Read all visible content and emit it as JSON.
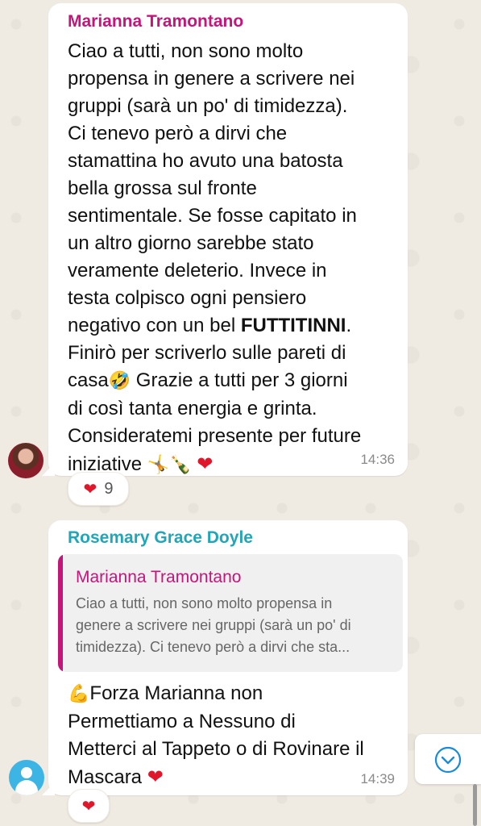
{
  "message1": {
    "sender": "Marianna Tramontano",
    "lines": [
      "Ciao a tutti, non sono molto",
      "propensa in genere a scrivere nei",
      "gruppi (sarà un po' di timidezza).",
      "Ci tenevo però a dirvi che",
      "stamattina ho avuto una batosta",
      "bella grossa sul fronte",
      "sentimentale. Se fosse capitato in",
      "un altro giorno sarebbe stato",
      "veramente deleterio. Invece in",
      "testa colpisco ogni pensiero"
    ],
    "line11_pre": "negativo con un bel ",
    "line11_bold": "FUTTITINNI",
    "line11_post": ".",
    "line12": "Finirò per scriverlo sulle pareti di",
    "line13_pre": "casa",
    "line13_emoji": "🤣",
    "line13_post": " Grazie a tutti per 3 giorni",
    "line14": "di così tanta energia e grinta.",
    "line15": "Consideratemi presente per future",
    "line16_text": "iniziative ",
    "line16_emojis": "🤸🍾",
    "line16_heart": "❤",
    "time": "14:36",
    "reaction_emoji": "❤",
    "reaction_count": "9"
  },
  "message2": {
    "sender": "Rosemary Grace Doyle",
    "quote_sender": "Marianna Tramontano",
    "quote_lines": [
      "Ciao a tutti, non sono molto propensa in",
      "genere a scrivere nei gruppi (sarà un po' di",
      "timidezza). Ci tenevo però a dirvi che sta..."
    ],
    "line1_emoji": "💪",
    "line1_text": "Forza Marianna non",
    "line2": "Permettiamo a Nessuno di",
    "line3": "Metterci al Tappeto o di Rovinare il",
    "line4_text": "Mascara ",
    "line4_heart": "❤",
    "time": "14:39",
    "reaction_emoji": "❤"
  },
  "scroll_button": {
    "icon": "chevron-down-circle-icon",
    "color": "#1a8bd6"
  }
}
